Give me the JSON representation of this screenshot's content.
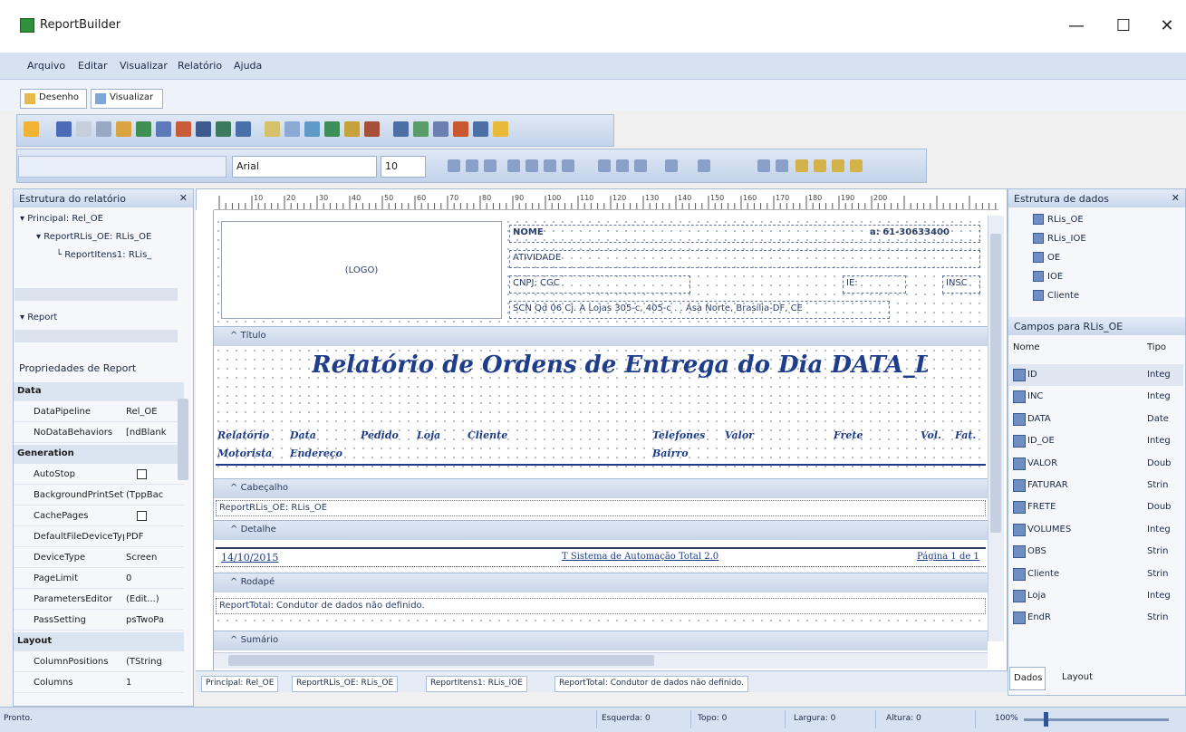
{
  "window": {
    "title": "ReportBuilder",
    "minimize": "—",
    "maximize": "☐",
    "close": "✕"
  },
  "menu": [
    "Arquivo",
    "Editar",
    "Visualizar",
    "Relatório",
    "Ajuda"
  ],
  "doc_tabs": [
    "Desenho",
    "Visualizar"
  ],
  "format": {
    "font": "Arial",
    "size": "10"
  },
  "report_tree": {
    "title": "Estrutura do relatório",
    "items": [
      "Principal: Rel_OE",
      "ReportRLis_OE: RLis_OE",
      "ReportItens1: RLis_",
      "Report"
    ]
  },
  "properties": {
    "title": "Propriedades de Report",
    "rows": [
      {
        "key": "Data",
        "value": "",
        "cat": true
      },
      {
        "key": "DataPipeline",
        "value": "Rel_OE"
      },
      {
        "key": "NoDataBehaviors",
        "value": "[ndBlank"
      },
      {
        "key": "Generation",
        "value": "",
        "cat": true
      },
      {
        "key": "AutoStop",
        "value": "",
        "check": true
      },
      {
        "key": "BackgroundPrintSettings",
        "value": "(TppBac"
      },
      {
        "key": "CachePages",
        "value": "",
        "check": true
      },
      {
        "key": "DefaultFileDeviceType",
        "value": "PDF"
      },
      {
        "key": "DeviceType",
        "value": "Screen"
      },
      {
        "key": "PageLimit",
        "value": "0"
      },
      {
        "key": "ParametersEditor",
        "value": "(Edit...)"
      },
      {
        "key": "PassSetting",
        "value": "psTwoPa"
      },
      {
        "key": "Layout",
        "value": "",
        "cat": true
      },
      {
        "key": "ColumnPositions",
        "value": "(TString"
      },
      {
        "key": "Columns",
        "value": "1"
      }
    ]
  },
  "ruler": {
    "marks": [
      "10",
      "20",
      "30",
      "40",
      "50",
      "60",
      "70",
      "80",
      "90",
      "100",
      "110",
      "120",
      "130",
      "140",
      "150",
      "160",
      "170",
      "180",
      "190",
      "200"
    ]
  },
  "header_block": {
    "logo": "(LOGO)",
    "nome": "NOME",
    "phone": "a: 61-30633400",
    "atividade": "ATIVIDADE",
    "cnpj": "CNPJ: CGC",
    "ie_label": "IE:",
    "insc": "INSC",
    "address": "SCN Qd 06 Cj. A Lojas 305-c, 405-c . . Asa Norte, Brasília-DF, CE"
  },
  "bands": {
    "titulo": "Título",
    "cabecalho": "Cabeçalho",
    "detalhe": "Detalhe",
    "rodape": "Rodapé",
    "sumario": "Sumário"
  },
  "title_text": "Relatório de Ordens de Entrega do Dia DATA_DIG",
  "columns_row1": [
    "Relatório",
    "Data",
    "Pedido",
    "Loja",
    "Cliente",
    "Telefones",
    "Valor",
    "Frete",
    "Vol.",
    "Fat."
  ],
  "columns_row2": [
    "Motorista",
    "Endereço",
    "Bairro"
  ],
  "cabecalho_text": "ReportRLis_OE: RLis_OE",
  "detail_row": {
    "left": "14/10/2015",
    "center": "T Sistema de Automação Total 2.0",
    "right": "Página 1 de 1"
  },
  "rodape_text": "ReportTotal: Condutor de dados não definido.",
  "sheet_tabs": [
    "Principal: Rel_OE",
    "ReportRLis_OE: RLis_OE",
    "ReportItens1: RLis_IOE",
    "ReportTotal: Condutor de dados não definido."
  ],
  "data_tree": {
    "title": "Estrutura de dados",
    "items": [
      "RLis_OE",
      "RLis_IOE",
      "OE",
      "IOE",
      "Cliente"
    ]
  },
  "fields": {
    "title": "Campos para RLis_OE",
    "col_name": "Nome",
    "col_type": "Tipo",
    "rows": [
      {
        "name": "ID",
        "type": "Integ"
      },
      {
        "name": "INC",
        "type": "Integ"
      },
      {
        "name": "DATA",
        "type": "Date"
      },
      {
        "name": "ID_OE",
        "type": "Integ"
      },
      {
        "name": "VALOR",
        "type": "Doub"
      },
      {
        "name": "FATURAR",
        "type": "Strin"
      },
      {
        "name": "FRETE",
        "type": "Doub"
      },
      {
        "name": "VOLUMES",
        "type": "Integ"
      },
      {
        "name": "OBS",
        "type": "Strin"
      },
      {
        "name": "Cliente",
        "type": "Strin"
      },
      {
        "name": "Loja",
        "type": "Integ"
      },
      {
        "name": "EndR",
        "type": "Strin"
      }
    ],
    "tabs": [
      "Dados",
      "Layout"
    ]
  },
  "status": {
    "ready": "Pronto.",
    "esquerda": "Esquerda: 0",
    "topo": "Topo: 0",
    "largura": "Largura: 0",
    "altura": "Altura: 0",
    "zoom": "100%"
  },
  "colors": {
    "accent": "#1e3d8a",
    "chrome": "#d6e2f2"
  }
}
